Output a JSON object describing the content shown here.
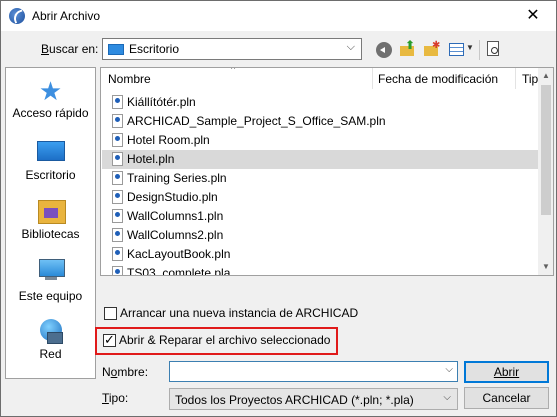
{
  "window": {
    "title": "Abrir Archivo",
    "close_glyph": "✕"
  },
  "lookin": {
    "label": "Buscar en:",
    "value": "Escritorio"
  },
  "places": [
    {
      "label": "Acceso rápido",
      "icon": "quick-access-star-icon"
    },
    {
      "label": "Escritorio",
      "icon": "desktop-icon"
    },
    {
      "label": "Bibliotecas",
      "icon": "libraries-icon"
    },
    {
      "label": "Este equipo",
      "icon": "this-pc-icon"
    },
    {
      "label": "Red",
      "icon": "network-icon"
    }
  ],
  "list": {
    "columns": [
      "Nombre",
      "Fecha de modificación",
      "Tip"
    ],
    "files": [
      {
        "name": "Kiállítótér.pln",
        "selected": false
      },
      {
        "name": "ARCHICAD_Sample_Project_S_Office_SAM.pln",
        "selected": false
      },
      {
        "name": "Hotel Room.pln",
        "selected": false
      },
      {
        "name": "Hotel.pln",
        "selected": true
      },
      {
        "name": "Training Series.pln",
        "selected": false
      },
      {
        "name": "DesignStudio.pln",
        "selected": false
      },
      {
        "name": "WallColumns1.pln",
        "selected": false
      },
      {
        "name": "WallColumns2.pln",
        "selected": false
      },
      {
        "name": "KacLayoutBook.pln",
        "selected": false
      },
      {
        "name": "TS03_complete.pla",
        "selected": false
      }
    ]
  },
  "options": {
    "new_instance": {
      "label": "Arrancar una nueva instancia de ARCHICAD",
      "checked": false
    },
    "open_repair": {
      "label": "Abrir & Reparar el archivo seleccionado",
      "checked": true
    }
  },
  "filename": {
    "label": "Nombre:",
    "value": ""
  },
  "filetype": {
    "label": "Tipo:",
    "value": "Todos los Proyectos ARCHICAD (*.pln; *.pla)"
  },
  "buttons": {
    "open": "Abrir",
    "cancel": "Cancelar"
  },
  "colors": {
    "highlight_border": "#e01a1a",
    "selection": "#d9d9d9"
  }
}
